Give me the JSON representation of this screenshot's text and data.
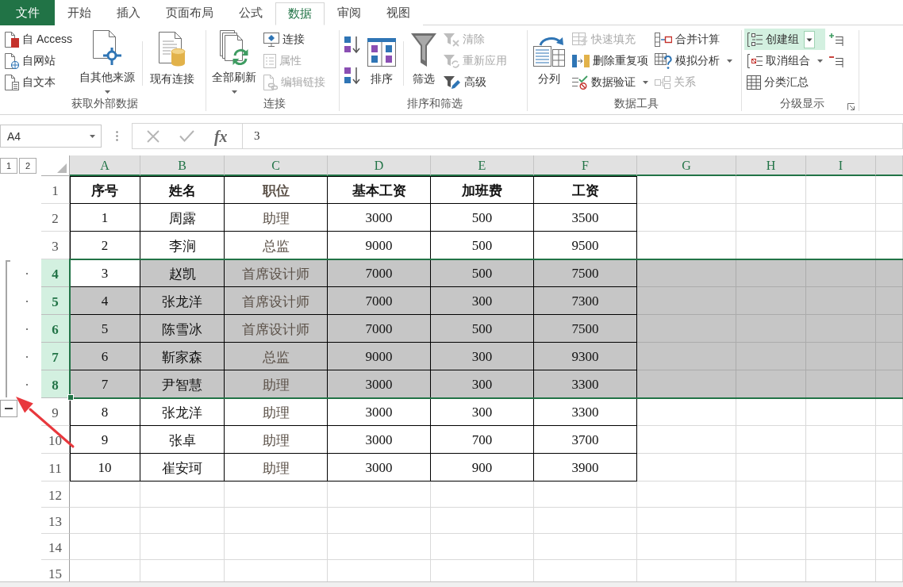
{
  "ribbon_tabs": [
    {
      "label": "文件",
      "kind": "file",
      "selected": false
    },
    {
      "label": "开始",
      "kind": "tab",
      "selected": false
    },
    {
      "label": "插入",
      "kind": "tab",
      "selected": false
    },
    {
      "label": "页面布局",
      "kind": "tab",
      "selected": false
    },
    {
      "label": "公式",
      "kind": "tab",
      "selected": false
    },
    {
      "label": "数据",
      "kind": "tab",
      "selected": true
    },
    {
      "label": "审阅",
      "kind": "tab",
      "selected": false
    },
    {
      "label": "视图",
      "kind": "tab",
      "selected": false
    }
  ],
  "ribbon_groups": [
    {
      "kind": "get_external_data",
      "label": "获取外部数据",
      "columns": [
        {
          "kind": "small",
          "items": [
            {
              "label": "自 Access",
              "disabled": false
            },
            {
              "label": "自网站",
              "disabled": false
            },
            {
              "label": "自文本",
              "disabled": false
            }
          ]
        },
        {
          "kind": "large",
          "items": [
            {
              "label": "自其他来源",
              "disabled": false,
              "dropdown": true
            }
          ]
        },
        {
          "kind": "large",
          "divider": true,
          "items": [
            {
              "label": "现有连接",
              "disabled": false
            }
          ]
        }
      ]
    },
    {
      "kind": "connections",
      "label": "连接",
      "columns": [
        {
          "kind": "large",
          "items": [
            {
              "label": "全部刷新",
              "disabled": false,
              "dropdown": true
            }
          ]
        },
        {
          "kind": "small",
          "items": [
            {
              "label": "连接",
              "disabled": false
            },
            {
              "label": "属性",
              "disabled": true
            },
            {
              "label": "编辑链接",
              "disabled": true
            }
          ]
        }
      ]
    },
    {
      "kind": "sort_filter",
      "label": "排序和筛选",
      "columns": [
        {
          "kind": "small",
          "items": [
            {
              "disabled": false
            },
            {
              "disabled": false
            }
          ]
        },
        {
          "kind": "large",
          "items": [
            {
              "label": "排序",
              "disabled": false
            }
          ]
        },
        {
          "kind": "large",
          "divider": true,
          "items": [
            {
              "label": "筛选",
              "disabled": false
            }
          ]
        },
        {
          "kind": "small",
          "items": [
            {
              "label": "清除",
              "disabled": true
            },
            {
              "label": "重新应用",
              "disabled": true
            },
            {
              "label": "高级",
              "disabled": false
            }
          ]
        }
      ]
    },
    {
      "kind": "data_tools",
      "label": "数据工具",
      "columns": [
        {
          "kind": "large",
          "items": [
            {
              "label": "分列",
              "disabled": false
            }
          ]
        },
        {
          "kind": "small",
          "items": [
            {
              "label": "快速填充",
              "disabled": true
            },
            {
              "label": "删除重复项",
              "disabled": false
            },
            {
              "label": "数据验证",
              "disabled": false,
              "dropdown": true
            }
          ]
        },
        {
          "kind": "small",
          "items": [
            {
              "label": "合并计算",
              "disabled": false
            },
            {
              "label": "模拟分析",
              "disabled": false,
              "dropdown": true
            },
            {
              "label": "关系",
              "disabled": true
            }
          ]
        }
      ]
    },
    {
      "kind": "outline",
      "label": "分级显示",
      "dialog_launcher": true,
      "columns": [
        {
          "kind": "small",
          "items": [
            {
              "label": "创建组",
              "disabled": false,
              "dropdown": true,
              "highlighted": true
            },
            {
              "label": "取消组合",
              "disabled": false,
              "dropdown": true,
              "highlighted": false
            },
            {
              "label": "分类汇总",
              "disabled": false,
              "highlighted": false
            }
          ]
        },
        {
          "kind": "small",
          "items": [
            {
              "disabled": false,
              "highlighted": false
            },
            {
              "disabled": false,
              "highlighted": false
            }
          ]
        }
      ]
    }
  ],
  "formula_bar": {
    "name_box": "A4",
    "function_button": "fx",
    "value": "3"
  },
  "outline_levels": [
    "1",
    "2"
  ],
  "columns": [
    {
      "label": "A",
      "highlighted": true
    },
    {
      "label": "B",
      "highlighted": true
    },
    {
      "label": "C",
      "highlighted": true
    },
    {
      "label": "D",
      "highlighted": true
    },
    {
      "label": "E",
      "highlighted": true
    },
    {
      "label": "F",
      "highlighted": true
    },
    {
      "label": "G",
      "highlighted": true
    },
    {
      "label": "H",
      "highlighted": true
    },
    {
      "label": "I",
      "highlighted": true
    }
  ],
  "rows": [
    {
      "header": "1",
      "kind": "header",
      "selected": false,
      "outlined": false,
      "cells": [
        {
          "text": "序号",
          "active": false
        },
        {
          "text": "姓名",
          "active": false
        },
        {
          "text": "职位",
          "active": false
        },
        {
          "text": "基本工资",
          "active": false
        },
        {
          "text": "加班费",
          "active": false
        },
        {
          "text": "工资",
          "active": false
        }
      ]
    },
    {
      "header": "2",
      "kind": "data",
      "selected": false,
      "outlined": false,
      "cells": [
        {
          "text": "1",
          "active": false
        },
        {
          "text": "周露",
          "active": false
        },
        {
          "text": "助理",
          "active": false
        },
        {
          "text": "3000",
          "active": false
        },
        {
          "text": "500",
          "active": false
        },
        {
          "text": "3500",
          "active": false
        }
      ]
    },
    {
      "header": "3",
      "kind": "data",
      "selected": false,
      "outlined": false,
      "cells": [
        {
          "text": "2",
          "active": false
        },
        {
          "text": "李涧",
          "active": false
        },
        {
          "text": "总监",
          "active": false
        },
        {
          "text": "9000",
          "active": false
        },
        {
          "text": "500",
          "active": false
        },
        {
          "text": "9500",
          "active": false
        }
      ]
    },
    {
      "header": "4",
      "kind": "data",
      "selected": true,
      "outlined": true,
      "cells": [
        {
          "text": "3",
          "active": true
        },
        {
          "text": "赵凯",
          "active": false
        },
        {
          "text": "首席设计师",
          "active": false
        },
        {
          "text": "7000",
          "active": false
        },
        {
          "text": "500",
          "active": false
        },
        {
          "text": "7500",
          "active": false
        }
      ]
    },
    {
      "header": "5",
      "kind": "data",
      "selected": true,
      "outlined": true,
      "cells": [
        {
          "text": "4",
          "active": false
        },
        {
          "text": "张龙洋",
          "active": false
        },
        {
          "text": "首席设计师",
          "active": false
        },
        {
          "text": "7000",
          "active": false
        },
        {
          "text": "300",
          "active": false
        },
        {
          "text": "7300",
          "active": false
        }
      ]
    },
    {
      "header": "6",
      "kind": "data",
      "selected": true,
      "outlined": true,
      "cells": [
        {
          "text": "5",
          "active": false
        },
        {
          "text": "陈雪冰",
          "active": false
        },
        {
          "text": "首席设计师",
          "active": false
        },
        {
          "text": "7000",
          "active": false
        },
        {
          "text": "500",
          "active": false
        },
        {
          "text": "7500",
          "active": false
        }
      ]
    },
    {
      "header": "7",
      "kind": "data",
      "selected": true,
      "outlined": true,
      "cells": [
        {
          "text": "6",
          "active": false
        },
        {
          "text": "靳家森",
          "active": false
        },
        {
          "text": "总监",
          "active": false
        },
        {
          "text": "9000",
          "active": false
        },
        {
          "text": "300",
          "active": false
        },
        {
          "text": "9300",
          "active": false
        }
      ]
    },
    {
      "header": "8",
      "kind": "data",
      "selected": true,
      "outlined": true,
      "cells": [
        {
          "text": "7",
          "active": false
        },
        {
          "text": "尹智慧",
          "active": false
        },
        {
          "text": "助理",
          "active": false
        },
        {
          "text": "3000",
          "active": false
        },
        {
          "text": "300",
          "active": false
        },
        {
          "text": "3300",
          "active": false
        }
      ]
    },
    {
      "header": "9",
      "kind": "data",
      "selected": false,
      "outlined": false,
      "cells": [
        {
          "text": "8",
          "active": false
        },
        {
          "text": "张龙洋",
          "active": false
        },
        {
          "text": "助理",
          "active": false
        },
        {
          "text": "3000",
          "active": false
        },
        {
          "text": "300",
          "active": false
        },
        {
          "text": "3300",
          "active": false
        }
      ]
    },
    {
      "header": "10",
      "kind": "data",
      "selected": false,
      "outlined": false,
      "cells": [
        {
          "text": "9",
          "active": false
        },
        {
          "text": "张卓",
          "active": false
        },
        {
          "text": "助理",
          "active": false
        },
        {
          "text": "3000",
          "active": false
        },
        {
          "text": "700",
          "active": false
        },
        {
          "text": "3700",
          "active": false
        }
      ]
    },
    {
      "header": "11",
      "kind": "data",
      "selected": false,
      "outlined": false,
      "cells": [
        {
          "text": "10",
          "active": false
        },
        {
          "text": "崔安珂",
          "active": false
        },
        {
          "text": "助理",
          "active": false
        },
        {
          "text": "3000",
          "active": false
        },
        {
          "text": "900",
          "active": false
        },
        {
          "text": "3900",
          "active": false
        }
      ]
    },
    {
      "header": "12",
      "kind": "empty",
      "selected": false,
      "outlined": false
    },
    {
      "header": "13",
      "kind": "empty",
      "selected": false,
      "outlined": false
    },
    {
      "header": "14",
      "kind": "empty",
      "selected": false,
      "outlined": false
    },
    {
      "header": "15",
      "kind": "empty",
      "selected": false,
      "outlined": false
    }
  ],
  "annotations": [
    {
      "kind": "arrow"
    }
  ]
}
